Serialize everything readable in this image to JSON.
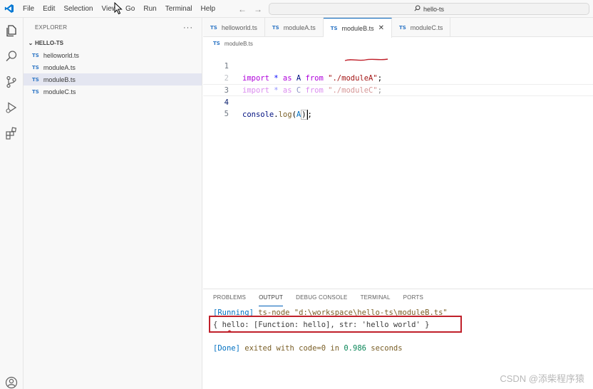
{
  "menu": [
    "File",
    "Edit",
    "Selection",
    "View",
    "Go",
    "Run",
    "Terminal",
    "Help"
  ],
  "search": {
    "label": "hello-ts"
  },
  "explorer": {
    "title": "EXPLORER",
    "more": "···",
    "folder": "HELLO-TS",
    "files": [
      {
        "badge": "TS",
        "name": "helloworld.ts"
      },
      {
        "badge": "TS",
        "name": "moduleA.ts"
      },
      {
        "badge": "TS",
        "name": "moduleB.ts",
        "selected": true
      },
      {
        "badge": "TS",
        "name": "moduleC.ts"
      }
    ]
  },
  "tabs": [
    {
      "badge": "TS",
      "name": "helloworld.ts"
    },
    {
      "badge": "TS",
      "name": "moduleA.ts"
    },
    {
      "badge": "TS",
      "name": "moduleB.ts",
      "active": true,
      "close": "✕"
    },
    {
      "badge": "TS",
      "name": "moduleC.ts"
    }
  ],
  "breadcrumb": {
    "badge": "TS",
    "file": "moduleB.ts"
  },
  "code": {
    "line_numbers": [
      "1",
      "2",
      "3",
      "4",
      "5"
    ],
    "line1": {
      "kw": "import",
      "star": " * ",
      "as": "as",
      "id": " A ",
      "from": "from",
      "sp": " ",
      "str_a": "\"./",
      "str_b": "moduleA",
      "str_c": "\"",
      "semi": ";"
    },
    "line2": {
      "kw": "import",
      "star": " * ",
      "as": "as",
      "id": " C ",
      "from": "from",
      "sp": " ",
      "str": "\"./moduleC\"",
      "semi": ";"
    },
    "line4": {
      "obj": "console",
      "dot": ".",
      "fn": "log",
      "open": "(",
      "arg": "A",
      "close": ")",
      "semi": ";"
    }
  },
  "panel": {
    "tabs": [
      "PROBLEMS",
      "OUTPUT",
      "DEBUG CONSOLE",
      "TERMINAL",
      "PORTS"
    ],
    "active_tab": "OUTPUT",
    "running_tag": "[Running]",
    "running_cmd": " ts-node \"d:\\workspace\\hello-ts\\moduleB.ts\"",
    "result": "{ hello: [Function: hello], str: 'hello world' }",
    "done_tag": "[Done]",
    "done_text_a": " exited with ",
    "done_code": "code=0",
    "done_text_b": " in ",
    "done_time": "0.986",
    "done_text_c": " seconds"
  },
  "watermark": "CSDN @添柴程序猿",
  "colors": {
    "accent": "#005fb8",
    "ts_badge": "#3178c6",
    "annotation": "#c0202a"
  }
}
